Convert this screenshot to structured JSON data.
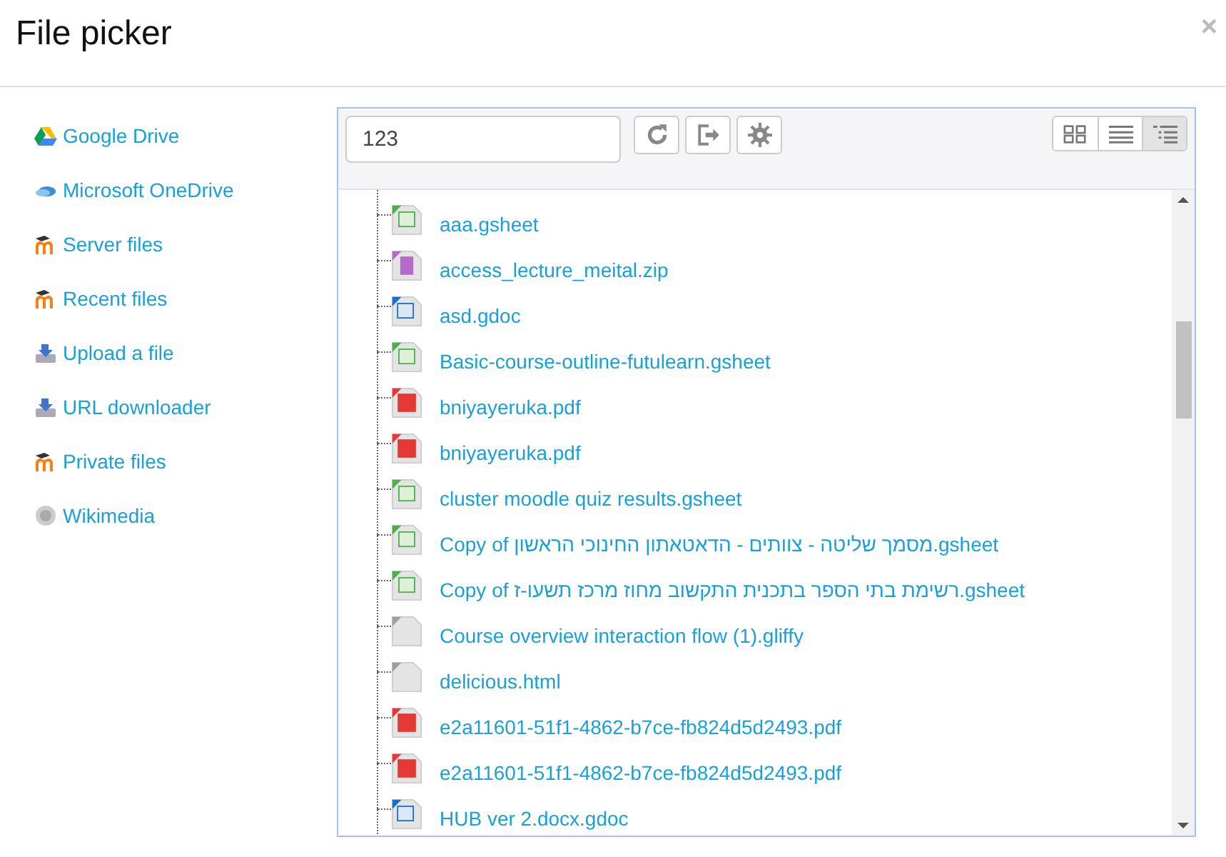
{
  "dialog": {
    "title": "File picker",
    "close": "×"
  },
  "sidebar": {
    "items": [
      {
        "label": "Google Drive",
        "kind": "drive"
      },
      {
        "label": "Microsoft OneDrive",
        "kind": "onedrive"
      },
      {
        "label": "Server files",
        "kind": "moodle"
      },
      {
        "label": "Recent files",
        "kind": "moodle"
      },
      {
        "label": "Upload a file",
        "kind": "upload"
      },
      {
        "label": "URL downloader",
        "kind": "upload"
      },
      {
        "label": "Private files",
        "kind": "moodle"
      },
      {
        "label": "Wikimedia",
        "kind": "wiki"
      }
    ]
  },
  "toolbar": {
    "search": {
      "value": "123"
    },
    "buttons": [
      {
        "kind": "refresh"
      },
      {
        "kind": "logout"
      },
      {
        "kind": "settings"
      }
    ],
    "views": [
      {
        "kind": "icons",
        "selected": false
      },
      {
        "kind": "list",
        "selected": false
      },
      {
        "kind": "tree",
        "selected": true
      }
    ]
  },
  "files": [
    {
      "name": "aaa.gsheet",
      "kind": "sheet"
    },
    {
      "name": "access_lecture_meital.zip",
      "kind": "zip"
    },
    {
      "name": "asd.gdoc",
      "kind": "doc"
    },
    {
      "name": "Basic-course-outline-futulearn.gsheet",
      "kind": "sheet"
    },
    {
      "name": "bniyayeruka.pdf",
      "kind": "pdf"
    },
    {
      "name": "bniyayeruka.pdf",
      "kind": "pdf"
    },
    {
      "name": "cluster moodle quiz results.gsheet",
      "kind": "sheet"
    },
    {
      "name": "Copy of מסמך שליטה - צוותים - הדאטאתון החינוכי הראשון.gsheet",
      "kind": "sheet"
    },
    {
      "name": "Copy of רשימת בתי הספר בתכנית התקשוב מחוז מרכז תשעו-ז.gsheet",
      "kind": "sheet"
    },
    {
      "name": "Course overview interaction flow (1).gliffy",
      "kind": "generic"
    },
    {
      "name": "delicious.html",
      "kind": "generic"
    },
    {
      "name": "e2a11601-51f1-4862-b7ce-fb824d5d2493.pdf",
      "kind": "pdf"
    },
    {
      "name": "e2a11601-51f1-4862-b7ce-fb824d5d2493.pdf",
      "kind": "pdf"
    },
    {
      "name": "HUB ver 2.docx.gdoc",
      "kind": "doc"
    }
  ]
}
